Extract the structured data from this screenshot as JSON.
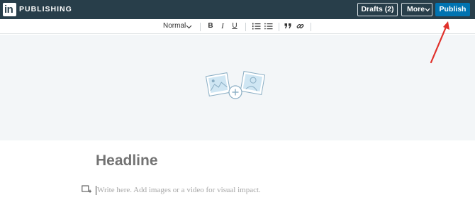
{
  "header": {
    "logo_text": "in",
    "brand": "PUBLISHING",
    "drafts_label": "Drafts (2)",
    "more_label": "More",
    "publish_label": "Publish"
  },
  "toolbar": {
    "paragraph_style": "Normal",
    "bold": "B",
    "italic": "I",
    "underline": "U"
  },
  "editor": {
    "headline_placeholder": "Headline",
    "body_placeholder": "Write here. Add images or a video for visual impact."
  },
  "colors": {
    "topbar": "#283e4a",
    "publish": "#0073b1",
    "cover_bg": "#f3f6f8",
    "annotation_arrow": "#e0312b"
  },
  "icons": [
    "chevron-down-icon",
    "ordered-list-icon",
    "bullet-list-icon",
    "quote-icon",
    "link-icon",
    "add-cover-image-icon",
    "add-media-icon"
  ]
}
